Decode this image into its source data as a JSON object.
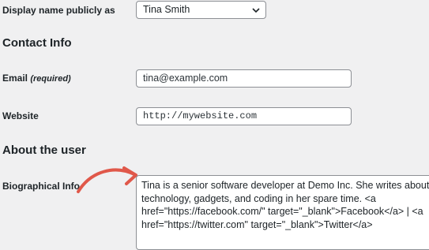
{
  "display_name": {
    "label": "Display name publicly as",
    "selected": "Tina Smith"
  },
  "contact": {
    "heading": "Contact Info",
    "email_label": "Email",
    "email_required": "(required)",
    "email_value": "tina@example.com",
    "website_label": "Website",
    "website_value": "http://mywebsite.com"
  },
  "about": {
    "heading": "About the user",
    "bio_label": "Biographical Info",
    "bio_value": "Tina is a senior software developer at Demo Inc. She writes about technology, gadgets, and coding in her spare time. <a href=\"https://facebook.com/\" target=\"_blank\">Facebook</a> | <a href=\"https://twitter.com\" target=\"_blank\">Twitter</a>"
  },
  "colors": {
    "background": "#f0f0f1",
    "input_border": "#8c8f94",
    "annotation_arrow": "#e0584a"
  },
  "icons": {
    "select_chevron": "chevron-down-icon",
    "annotation": "curved-arrow-icon"
  }
}
